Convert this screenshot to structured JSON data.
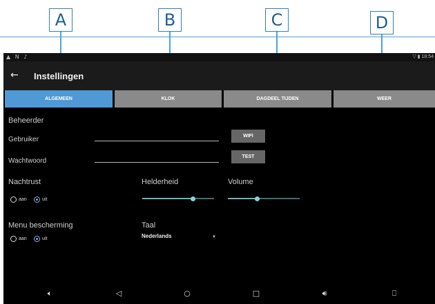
{
  "callouts": [
    "A",
    "B",
    "C",
    "D"
  ],
  "status": {
    "left_icons": "▲ N ♪",
    "right_text": "▽ ▮ 18:54"
  },
  "appbar": {
    "title": "Instellingen",
    "back_icon": "arrow-left-icon"
  },
  "tabs": [
    {
      "label": "ALGEMEEN",
      "active": true
    },
    {
      "label": "KLOK",
      "active": false
    },
    {
      "label": "DAGDEEL TIJDEN",
      "active": false
    },
    {
      "label": "WEER",
      "active": false
    }
  ],
  "content": {
    "beheerder_label": "Beheerder",
    "gebruiker_label": "Gebruiker",
    "wachtwoord_label": "Wachtwoord",
    "wifi_button": "WIFI",
    "test_button": "TEST",
    "nachtrust_label": "Nachtrust",
    "nachtrust_options": {
      "aan": "aan",
      "uit": "uit",
      "selected": "uit"
    },
    "helderheid_label": "Helderheid",
    "helderheid_value": 0.7,
    "volume_label": "Volume",
    "volume_value": 0.4,
    "menu_label": "Menu bescherming",
    "menu_options": {
      "aan": "aan",
      "uit": "uit",
      "selected": "uit"
    },
    "taal_label": "Taal",
    "taal_value": "Nederlands"
  },
  "navbar": [
    "speaker-low-icon",
    "back-triangle-icon",
    "home-circle-icon",
    "recents-square-icon",
    "speaker-high-icon",
    "camera-icon"
  ]
}
